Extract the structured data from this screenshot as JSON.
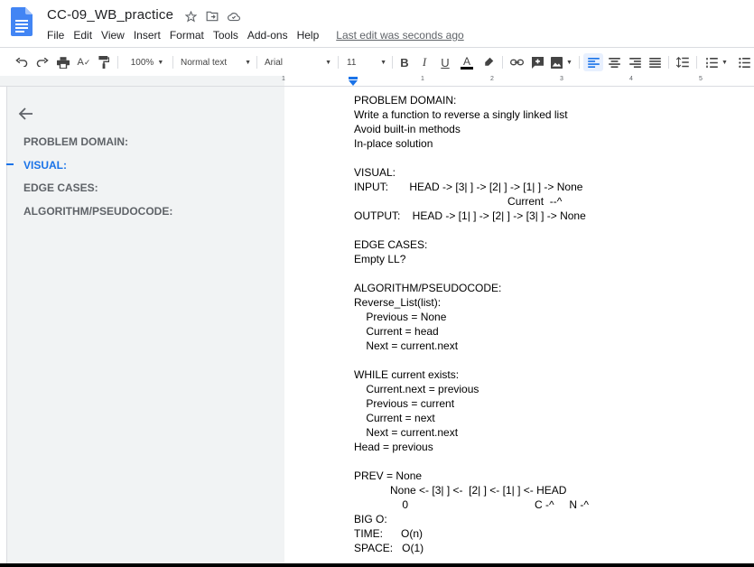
{
  "doc_title": "CC-09_WB_practice",
  "menu": [
    "File",
    "Edit",
    "View",
    "Insert",
    "Format",
    "Tools",
    "Add-ons",
    "Help"
  ],
  "last_edit": "Last edit was seconds ago",
  "toolbar": {
    "zoom": "100%",
    "style": "Normal text",
    "font": "Arial",
    "size": "11"
  },
  "ruler_numbers": [
    "1",
    "1",
    "2",
    "3",
    "4",
    "5"
  ],
  "outline": [
    "PROBLEM DOMAIN:",
    "VISUAL:",
    "EDGE CASES:",
    "ALGORITHM/PSEUDOCODE:"
  ],
  "outline_active": "VISUAL:",
  "body_lines": [
    "PROBLEM DOMAIN:",
    "Write a function to reverse a singly linked list",
    "Avoid built-in methods",
    "In-place solution",
    "",
    "VISUAL:",
    "INPUT:       HEAD -> [3| ] -> [2| ] -> [1| ] -> None",
    "                                                   Current  --^",
    "OUTPUT:    HEAD -> [1| ] -> [2| ] -> [3| ] -> None",
    "",
    "EDGE CASES:",
    "Empty LL?",
    "",
    "ALGORITHM/PSEUDOCODE:",
    "Reverse_List(list):",
    "    Previous = None",
    "    Current = head",
    "    Next = current.next",
    "",
    "WHILE current exists:",
    "    Current.next = previous",
    "    Previous = current",
    "    Current = next",
    "    Next = current.next",
    "Head = previous",
    "",
    "PREV = None",
    "            None <- [3| ] <-  [2| ] <- [1| ] <- HEAD",
    "                0                                          C -^     N -^",
    "BIG O:",
    "TIME:      O(n)",
    "SPACE:   O(1)"
  ],
  "colors": {
    "accent": "#1a73e8",
    "doc_blue": "#4285f4"
  }
}
